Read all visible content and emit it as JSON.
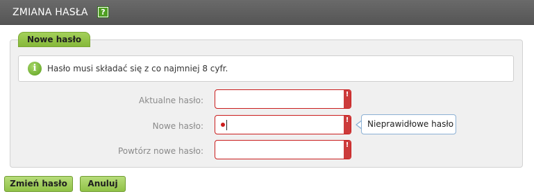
{
  "header": {
    "title": "ZMIANA HASŁA",
    "help_icon": "help-icon",
    "help_glyph": "?"
  },
  "panel": {
    "tab_label": "Nowe hasło"
  },
  "info": {
    "icon": "info-icon",
    "icon_glyph": "i",
    "text": "Hasło musi składać się z co najmniej 8 cyfr."
  },
  "form": {
    "current_password": {
      "label": "Aktualne hasło:",
      "value": "",
      "error_marker": "!"
    },
    "new_password": {
      "label": "Nowe hasło:",
      "value": "•",
      "error_marker": "!"
    },
    "repeat_password": {
      "label": "Powtórz nowe hasło:",
      "value": "",
      "error_marker": "!"
    }
  },
  "tooltip": {
    "text": "Nieprawidłowe hasło"
  },
  "buttons": {
    "change_label": "Zmień hasło",
    "cancel_label": "Anuluj"
  },
  "colors": {
    "accent_green": "#8fc142",
    "error_red": "#c91c1c",
    "header_gray": "#5e5e5e"
  }
}
